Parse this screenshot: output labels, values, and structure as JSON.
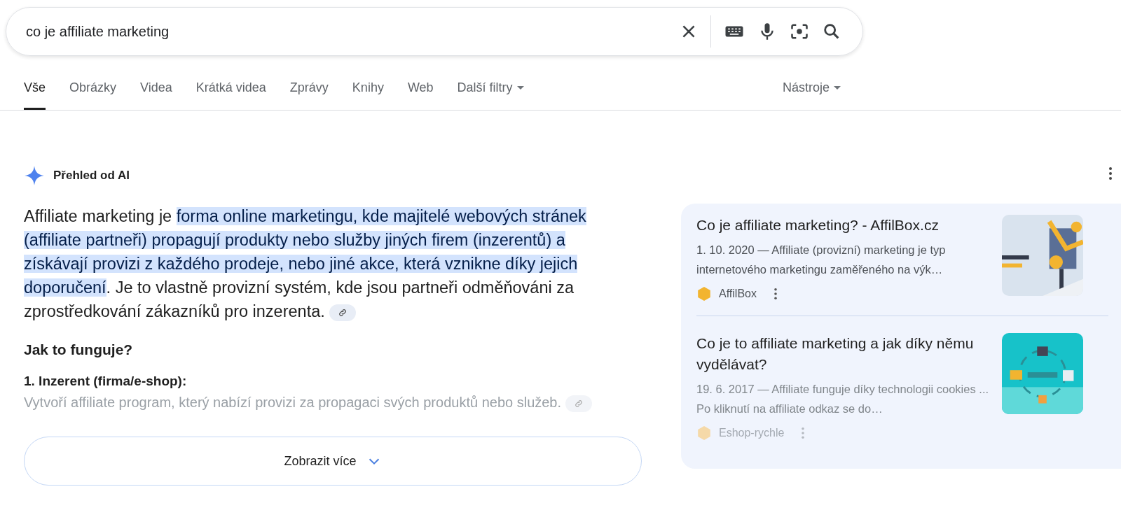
{
  "search": {
    "value": "co je affiliate marketing"
  },
  "tabs": [
    {
      "label": "Vše",
      "selected": true,
      "menu": false
    },
    {
      "label": "Obrázky",
      "selected": false,
      "menu": false
    },
    {
      "label": "Videa",
      "selected": false,
      "menu": false
    },
    {
      "label": "Krátká videa",
      "selected": false,
      "menu": false
    },
    {
      "label": "Zprávy",
      "selected": false,
      "menu": false
    },
    {
      "label": "Knihy",
      "selected": false,
      "menu": false
    },
    {
      "label": "Web",
      "selected": false,
      "menu": false
    },
    {
      "label": "Další filtry",
      "selected": false,
      "menu": true
    }
  ],
  "tools": {
    "label": "Nástroje"
  },
  "ai_overview": {
    "title": "Přehled od AI",
    "intro": "Affiliate marketing je **forma online marketingu, kde majitelé webových stránek (affiliate partneři) propagují produkty nebo služby jiných firem (inzerentů) a získávají provizi z každého prodeje, nebo jiné akce, která vznikne díky jejich doporučení**. Je to vlastně provizní systém, kde jsou partneři odměňováni za zprostředkování zákazníků pro inzerenta.",
    "heading": "Jak to funguje?",
    "steps": [
      {
        "title": "1. Inzerent (firma/e-shop):",
        "text": "Vytvoří affiliate program, který nabízí provizi za propagaci svých produktů nebo služeb."
      }
    ],
    "show_more": "Zobrazit více"
  },
  "sources": [
    {
      "title": "Co je affiliate marketing? - AffilBox.cz",
      "snippet": "1. 10. 2020 — Affiliate (provizní) marketing je typ internetového marketingu zaměřeného na výk…",
      "site": "AffilBox",
      "faded": false,
      "color": "#f2b430"
    },
    {
      "title": "Co je to affiliate marketing a jak díky němu vydělávat?",
      "snippet": "19. 6. 2017 — Affiliate funguje díky technologii cookies ... Po kliknutí na affiliate odkaz se do…",
      "site": "Eshop-rychle",
      "faded": true,
      "color": "#f5d9a8"
    }
  ]
}
